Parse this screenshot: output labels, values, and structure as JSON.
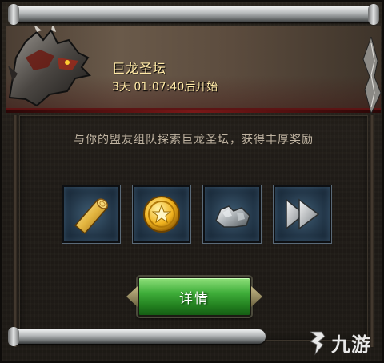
{
  "event": {
    "title": "巨龙圣坛",
    "countdown": "3天 01:07:40后开始",
    "description": "与你的盟友组队探索巨龙圣坛，获得丰厚奖励"
  },
  "rewards": [
    {
      "icon": "wood-log-icon"
    },
    {
      "icon": "gold-coin-icon"
    },
    {
      "icon": "silver-ore-icon"
    },
    {
      "icon": "fast-forward-icon"
    }
  ],
  "actions": {
    "details_label": "详情"
  },
  "watermark": {
    "text": "九游"
  },
  "colors": {
    "title_text": "#ffe9a6",
    "description_text": "#bfb3a1",
    "button_green": "#3fae3a",
    "slot_blue": "#2d4a5f",
    "header_red_trim": "#7a1818"
  }
}
